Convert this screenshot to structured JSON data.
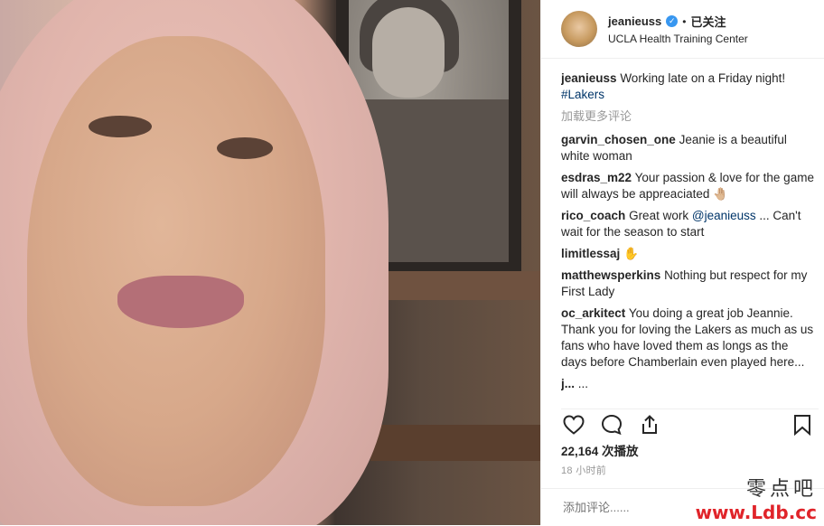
{
  "post": {
    "username": "jeanieuss",
    "follow_label": "已关注",
    "location": "UCLA Health Training Center",
    "caption_user": "jeanieuss",
    "caption_text": "Working late on a Friday night!",
    "caption_tag": "#Lakers",
    "load_more": "加载更多评论",
    "views": "22,164 次播放",
    "time_ago": "18 小时前",
    "comment_placeholder": "添加评论......"
  },
  "comments": [
    {
      "user": "garvin_chosen_one",
      "text": "Jeanie is a beautiful white woman"
    },
    {
      "user": "esdras_m22",
      "text": "Your passion & love for the game will always be appreaciated 🤚🏼"
    },
    {
      "user": "rico_coach",
      "text_before": "Great work",
      "mention": "@jeanieuss",
      "text_after": "... Can't wait for the season to start"
    },
    {
      "user": "limitlessaj",
      "text": "✋"
    },
    {
      "user": "matthewsperkins",
      "text": "Nothing but respect for my First Lady"
    },
    {
      "user": "oc_arkitect",
      "text": "You doing a great job Jeannie. Thank you for loving the Lakers as much as us fans who have loved them as longs as the days before Chamberlain even played here..."
    },
    {
      "user": "j...",
      "text": "..."
    }
  ],
  "watermark": {
    "line1": "零点吧",
    "line2": "www.Ldb.cc"
  },
  "colors": {
    "verified": "#3897f0",
    "mention": "#003569",
    "watermark_red": "#e0242a"
  }
}
